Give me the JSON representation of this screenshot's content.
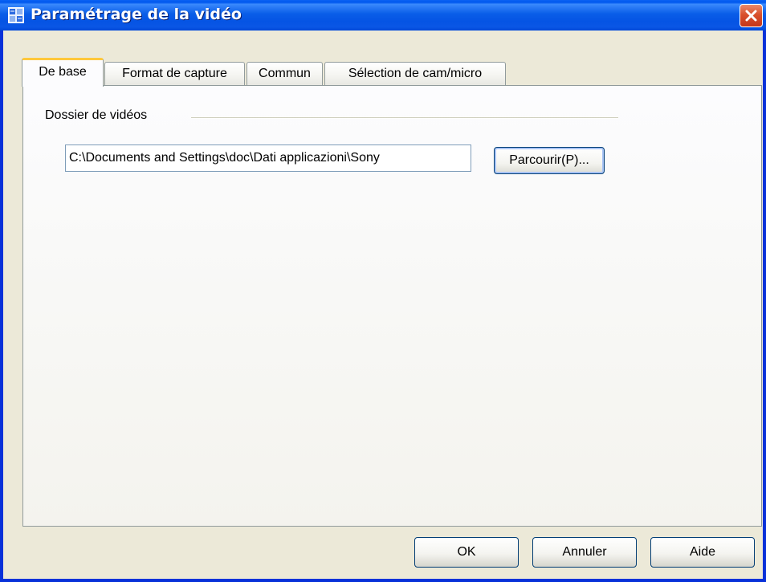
{
  "window": {
    "title": "Paramétrage de la vidéo"
  },
  "tabs": [
    {
      "label": "De base",
      "active": true
    },
    {
      "label": "Format de capture",
      "active": false
    },
    {
      "label": "Commun",
      "active": false
    },
    {
      "label": "Sélection de cam/micro",
      "active": false
    }
  ],
  "basic": {
    "group_label": "Dossier de vidéos",
    "folder_path": "C:\\Documents and Settings\\doc\\Dati applicazioni\\Sony",
    "browse_label": "Parcourir(P)..."
  },
  "buttons": {
    "ok": "OK",
    "cancel": "Annuler",
    "help": "Aide"
  },
  "icons": {
    "title_icon": "video-settings-icon",
    "close_icon": "close-icon"
  },
  "colors": {
    "titlebar": "#0058ee",
    "close_button": "#d9512d",
    "active_tab_highlight": "#ffc83c",
    "dialog_background": "#ece9d8"
  }
}
